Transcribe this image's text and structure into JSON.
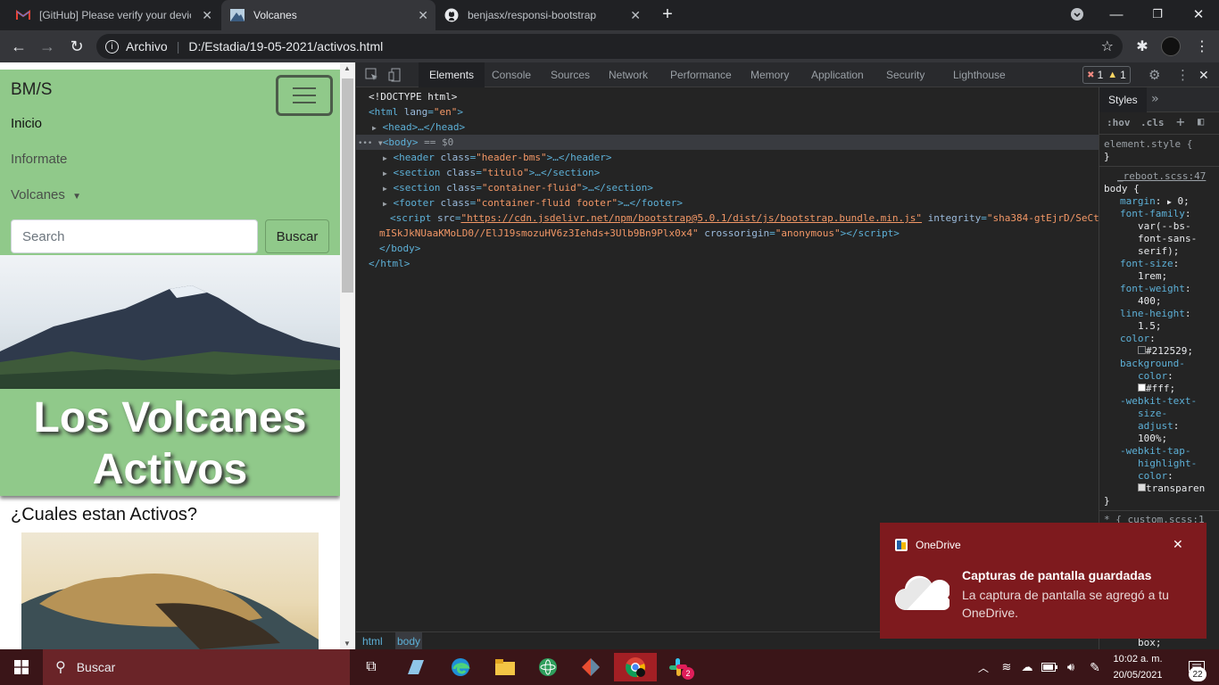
{
  "browser": {
    "tabs": [
      {
        "title": "[GitHub] Please verify your device",
        "icon": "gmail-icon"
      },
      {
        "title": "Volcanes",
        "icon": "volcano-icon"
      },
      {
        "title": "benjasx/responsi-bootstrap",
        "icon": "github-icon"
      }
    ],
    "new_tab": "+",
    "address_scheme": "Archivo",
    "address_path": "D:/Estadia/19-05-2021/activos.html"
  },
  "page": {
    "brand": "BM/S",
    "nav": [
      "Inicio",
      "Informate",
      "Volcanes"
    ],
    "search_placeholder": "Search",
    "search_button": "Buscar",
    "title_line1": "Los Volcanes",
    "title_line2": "Activos",
    "subtitle": "¿Cuales estan Activos?",
    "accent": "#90c98a"
  },
  "devtools": {
    "tabs": [
      "Elements",
      "Console",
      "Sources",
      "Network",
      "Performance",
      "Memory",
      "Application",
      "Security",
      "Lighthouse"
    ],
    "errors": "1",
    "warnings": "1",
    "dom": {
      "doctype": "<!DOCTYPE html>",
      "html_open": "<html",
      "html_lang_attr": "lang",
      "html_lang_val": "\"en\"",
      "head": "<head>…</head>",
      "body_open": "<body>",
      "body_eq": "== $0",
      "header_tag": "<header",
      "header_class": "\"header-bms\"",
      "header_close": ">…</header>",
      "section1_class": "\"titulo\"",
      "section_close": ">…</section>",
      "section2_class": "\"container-fluid\"",
      "footer_class": "\"container-fluid footer\"",
      "footer_close": ">…</footer>",
      "script_src": "\"https://cdn.jsdelivr.net/npm/bootstrap@5.0.1/dist/js/bootstrap.bundle.min.js\"",
      "script_integrity_a": "\"sha384-gtEjrD/SeCt",
      "script_integrity_b": "mISkJkNUaaKMoLD0//ElJ19smozuHV6z3Iehds+3Ulb9Bn9Plx0x4\"",
      "script_crossorigin": "\"anonymous\"",
      "body_close": "</body>",
      "html_close": "</html>"
    },
    "breadcrumbs": [
      "html",
      "body"
    ],
    "styles": {
      "tab": "Styles",
      "hov": ":hov",
      "cls": ".cls",
      "element_style": "element.style {",
      "close_brace": "}",
      "source": "_reboot.scss:47",
      "selector": "body {",
      "margin_p": "margin",
      "margin_v": "0;",
      "ff_p": "font-family",
      "ff_v1": "var(--bs-",
      "ff_v2": "font-sans-",
      "ff_v3": "serif);",
      "fs_p": "font-size",
      "fs_v": "1rem;",
      "fw_p": "font-weight",
      "fw_v": "400;",
      "lh_p": "line-height",
      "lh_v": "1.5;",
      "color_p": "color",
      "color_v": "#212529;",
      "bg_p1": "background-",
      "bg_p2": "color",
      "bg_v": "#fff;",
      "wts_p1": "-webkit-text-",
      "wts_p2": "size-",
      "wts_p3": "adjust",
      "wts_v": "100%;",
      "wth_p1": "-webkit-tap-",
      "wth_p2": "highlight-",
      "wth_p3": "color",
      "wth_v": "transparen",
      "next_rule": "* {   custom.scss:1",
      "box": "box;"
    }
  },
  "notification": {
    "app": "OneDrive",
    "title": "Capturas de pantalla guardadas",
    "body": "La captura de pantalla se agregó a tu OneDrive."
  },
  "taskbar": {
    "search": "Buscar",
    "time": "10:02 a. m.",
    "date": "20/05/2021",
    "badge": "22",
    "slack_badge": "2"
  }
}
